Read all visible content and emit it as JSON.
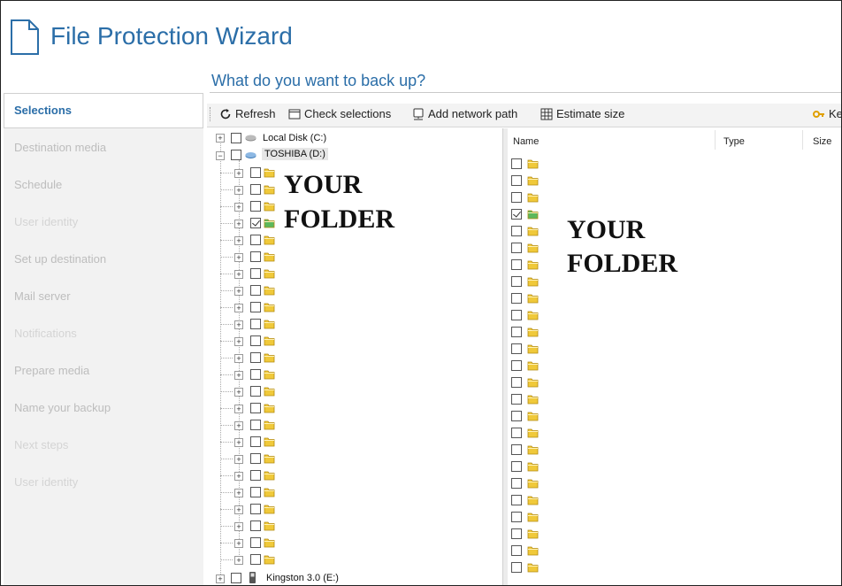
{
  "app": {
    "title": "File Protection Wizard",
    "subtitle": "What do you want to back up?"
  },
  "nav": {
    "items": [
      {
        "label": "Selections",
        "active": true
      },
      {
        "label": "Destination media"
      },
      {
        "label": "Schedule"
      },
      {
        "label": "User identity"
      },
      {
        "label": "Set up destination"
      },
      {
        "label": "Mail server"
      },
      {
        "label": "Notifications"
      },
      {
        "label": "Prepare media"
      },
      {
        "label": "Name your backup"
      },
      {
        "label": "Next steps"
      },
      {
        "label": "User identity"
      }
    ]
  },
  "toolbar": {
    "refresh": "Refresh",
    "check_selections": "Check selections",
    "add_network_path": "Add network path",
    "estimate_size": "Estimate size",
    "key_truncated": "Ke"
  },
  "tree": {
    "drives": [
      {
        "label": "Local Disk (C:)",
        "icon": "hard-drive-icon"
      },
      {
        "label": "TOSHIBA (D:)",
        "icon": "external-drive-icon",
        "selected": true
      },
      {
        "label": "Kingston 3.0 (E:)",
        "icon": "usb-drive-icon"
      }
    ],
    "folder_count": 24,
    "checked_folder_index": 3,
    "annotation": [
      "YOUR",
      "FOLDER"
    ]
  },
  "list": {
    "columns": {
      "name": "Name",
      "type": "Type",
      "size": "Size"
    },
    "row_count": 25,
    "checked_row_index": 3,
    "annotation": [
      "YOUR",
      "FOLDER"
    ]
  },
  "colors": {
    "accent": "#2b6ea8",
    "folder": "#f0c93a",
    "folder_checked": "#5cb85c"
  }
}
